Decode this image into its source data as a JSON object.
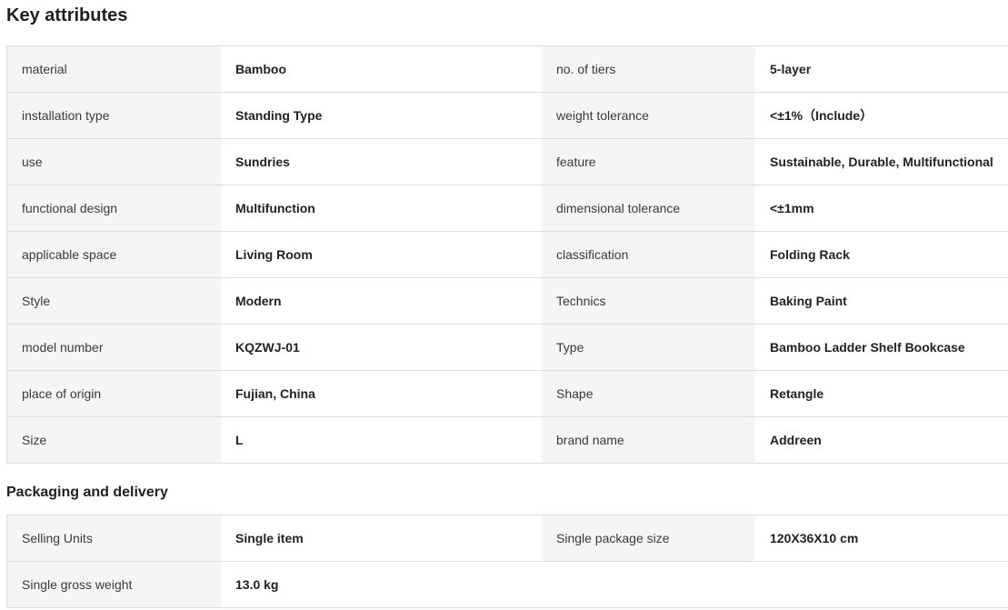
{
  "key_attributes": {
    "title": "Key attributes",
    "rows": [
      {
        "l1": "material",
        "v1": "Bamboo",
        "l2": "no. of tiers",
        "v2": "5-layer"
      },
      {
        "l1": "installation type",
        "v1": "Standing Type",
        "l2": "weight tolerance",
        "v2": "<±1%（Include）"
      },
      {
        "l1": "use",
        "v1": "Sundries",
        "l2": "feature",
        "v2": "Sustainable, Durable, Multifunctional"
      },
      {
        "l1": "functional design",
        "v1": "Multifunction",
        "l2": "dimensional tolerance",
        "v2": "<±1mm"
      },
      {
        "l1": "applicable space",
        "v1": "Living Room",
        "l2": "classification",
        "v2": "Folding Rack"
      },
      {
        "l1": "Style",
        "v1": "Modern",
        "l2": "Technics",
        "v2": "Baking Paint"
      },
      {
        "l1": "model number",
        "v1": "KQZWJ-01",
        "l2": "Type",
        "v2": "Bamboo Ladder Shelf Bookcase"
      },
      {
        "l1": "place of origin",
        "v1": "Fujian, China",
        "l2": "Shape",
        "v2": "Retangle"
      },
      {
        "l1": "Size",
        "v1": "L",
        "l2": "brand name",
        "v2": "Addreen"
      }
    ]
  },
  "packaging": {
    "title": "Packaging and delivery",
    "rows": [
      {
        "l1": "Selling Units",
        "v1": "Single item",
        "l2": "Single package size",
        "v2": "120X36X10 cm"
      },
      {
        "l1": "Single gross weight",
        "v1": "13.0 kg"
      }
    ]
  }
}
